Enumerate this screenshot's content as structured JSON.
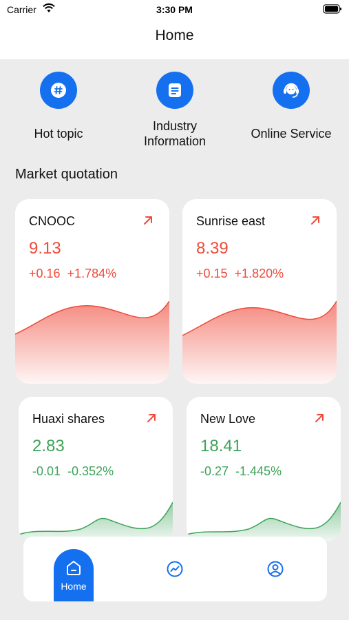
{
  "status_bar": {
    "carrier": "Carrier",
    "time": "3:30 PM"
  },
  "nav": {
    "title": "Home"
  },
  "quick_actions": [
    {
      "label": "Hot topic",
      "icon": "hashtag-icon"
    },
    {
      "label_line1": "Industry",
      "label_line2": "Information",
      "icon": "document-icon"
    },
    {
      "label": "Online Service",
      "icon": "customer-service-icon"
    }
  ],
  "market": {
    "title": "Market quotation",
    "stocks": [
      {
        "name": "CNOOC",
        "price": "9.13",
        "change": "+0.16",
        "percent": "+1.784%",
        "trend": "up"
      },
      {
        "name": "Sunrise east",
        "price": "8.39",
        "change": "+0.15",
        "percent": "+1.820%",
        "trend": "up"
      },
      {
        "name": "Huaxi shares",
        "price": "2.83",
        "change": "-0.01",
        "percent": "-0.352%",
        "trend": "down"
      },
      {
        "name": "New Love",
        "price": "18.41",
        "change": "-0.27",
        "percent": "-1.445%",
        "trend": "down"
      }
    ]
  },
  "tabbar": {
    "home_label": "Home"
  },
  "colors": {
    "accent": "#1570ef",
    "up": "#ef4a3a",
    "down": "#3ea35a",
    "background": "#ececec"
  }
}
